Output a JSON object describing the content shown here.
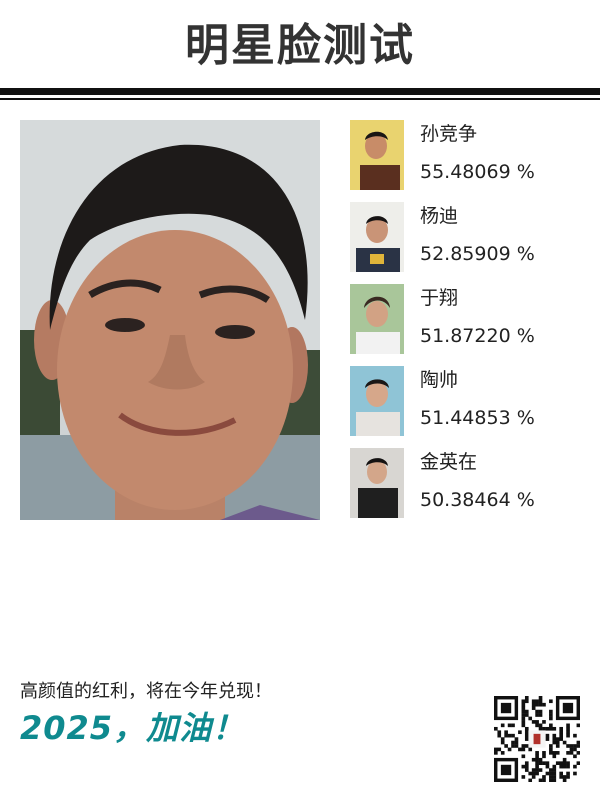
{
  "header": {
    "title": "明星脸测试"
  },
  "photo": {
    "icon": "user-face-photo"
  },
  "matches": [
    {
      "name": "孙竞争",
      "score": "55.48069 %"
    },
    {
      "name": "杨迪",
      "score": "52.85909 %"
    },
    {
      "name": "于翔",
      "score": "51.87220 %"
    },
    {
      "name": "陶帅",
      "score": "51.44853 %"
    },
    {
      "name": "金英在",
      "score": "50.38464 %"
    }
  ],
  "footer": {
    "slogan": "高颜值的红利，将在今年兑现！",
    "cheer": "2025，加油！",
    "qr_icon": "qr-code-icon"
  },
  "colors": {
    "accent": "#0f8a8f",
    "rule": "#111111"
  }
}
